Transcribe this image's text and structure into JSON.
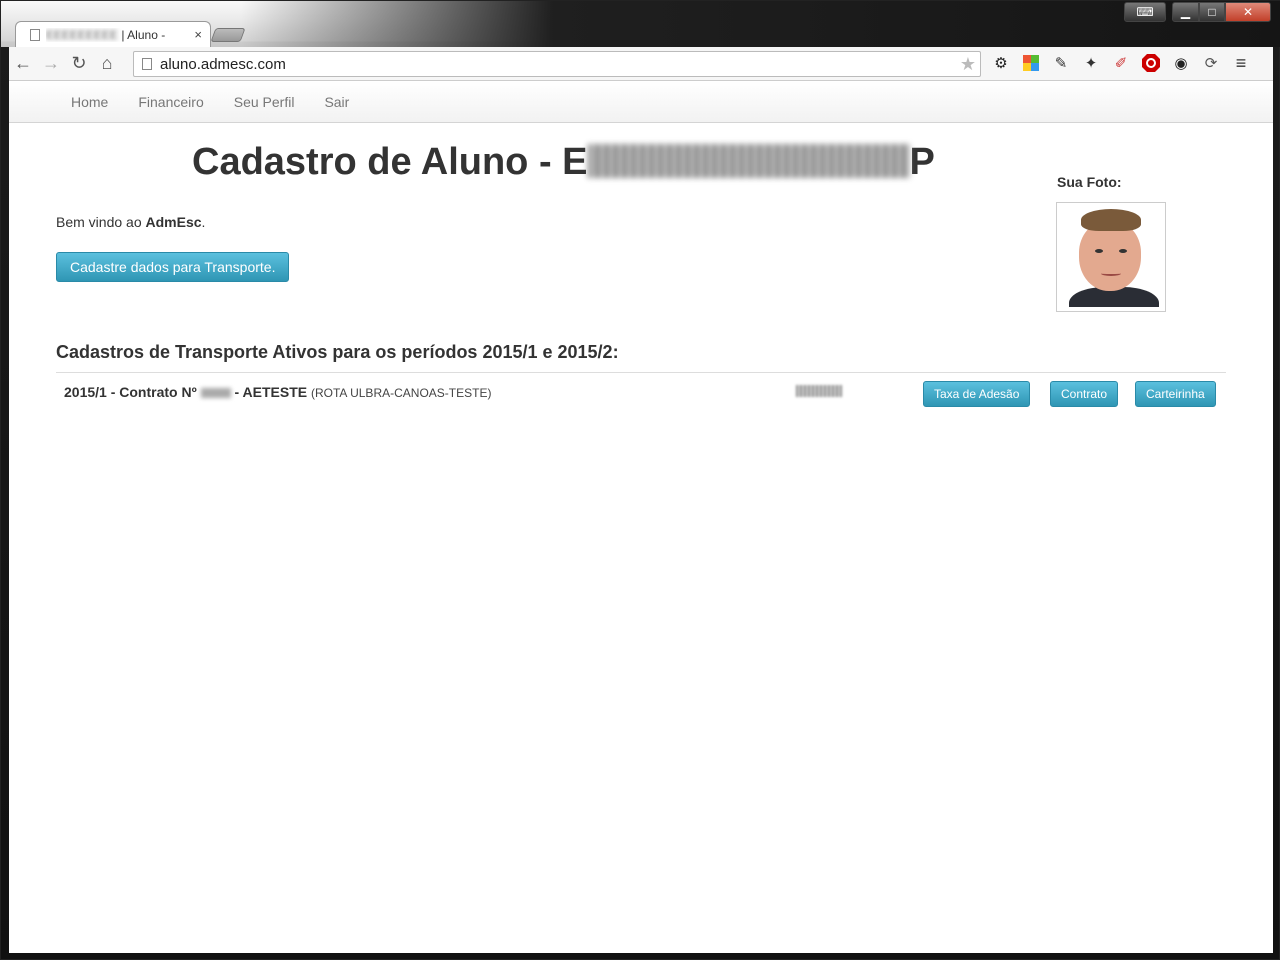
{
  "browser": {
    "tab_title_suffix": "| Aluno -",
    "tab_close": "×",
    "url": "aluno.admesc.com",
    "back": "←",
    "forward": "→",
    "reload": "↻",
    "home": "⌂",
    "star": "★",
    "menu": "≡"
  },
  "nav": {
    "items": [
      "Home",
      "Financeiro",
      "Seu Perfil",
      "Sair"
    ]
  },
  "page": {
    "heading_prefix": "Cadastro de Aluno - E",
    "heading_suffix": "P",
    "photo_label": "Sua Foto:",
    "welcome_prefix": "Bem vindo ao ",
    "welcome_brand": "AdmEsc",
    "welcome_suffix": ".",
    "transport_button": "Cadastre dados para Transporte.",
    "section_title": "Cadastros de Transporte Ativos para os períodos 2015/1 e 2015/2:"
  },
  "contracts": [
    {
      "prefix": "2015/1 - Contrato Nº",
      "suffix": "- AETESTE",
      "route": "(ROTA ULBRA-CANOAS-TESTE)",
      "buttons": [
        "Taxa de Adesão",
        "Contrato",
        "Carteirinha"
      ]
    }
  ],
  "colors": {
    "button": "#2f96b4",
    "heading": "#333333",
    "nav_text": "#777777"
  }
}
